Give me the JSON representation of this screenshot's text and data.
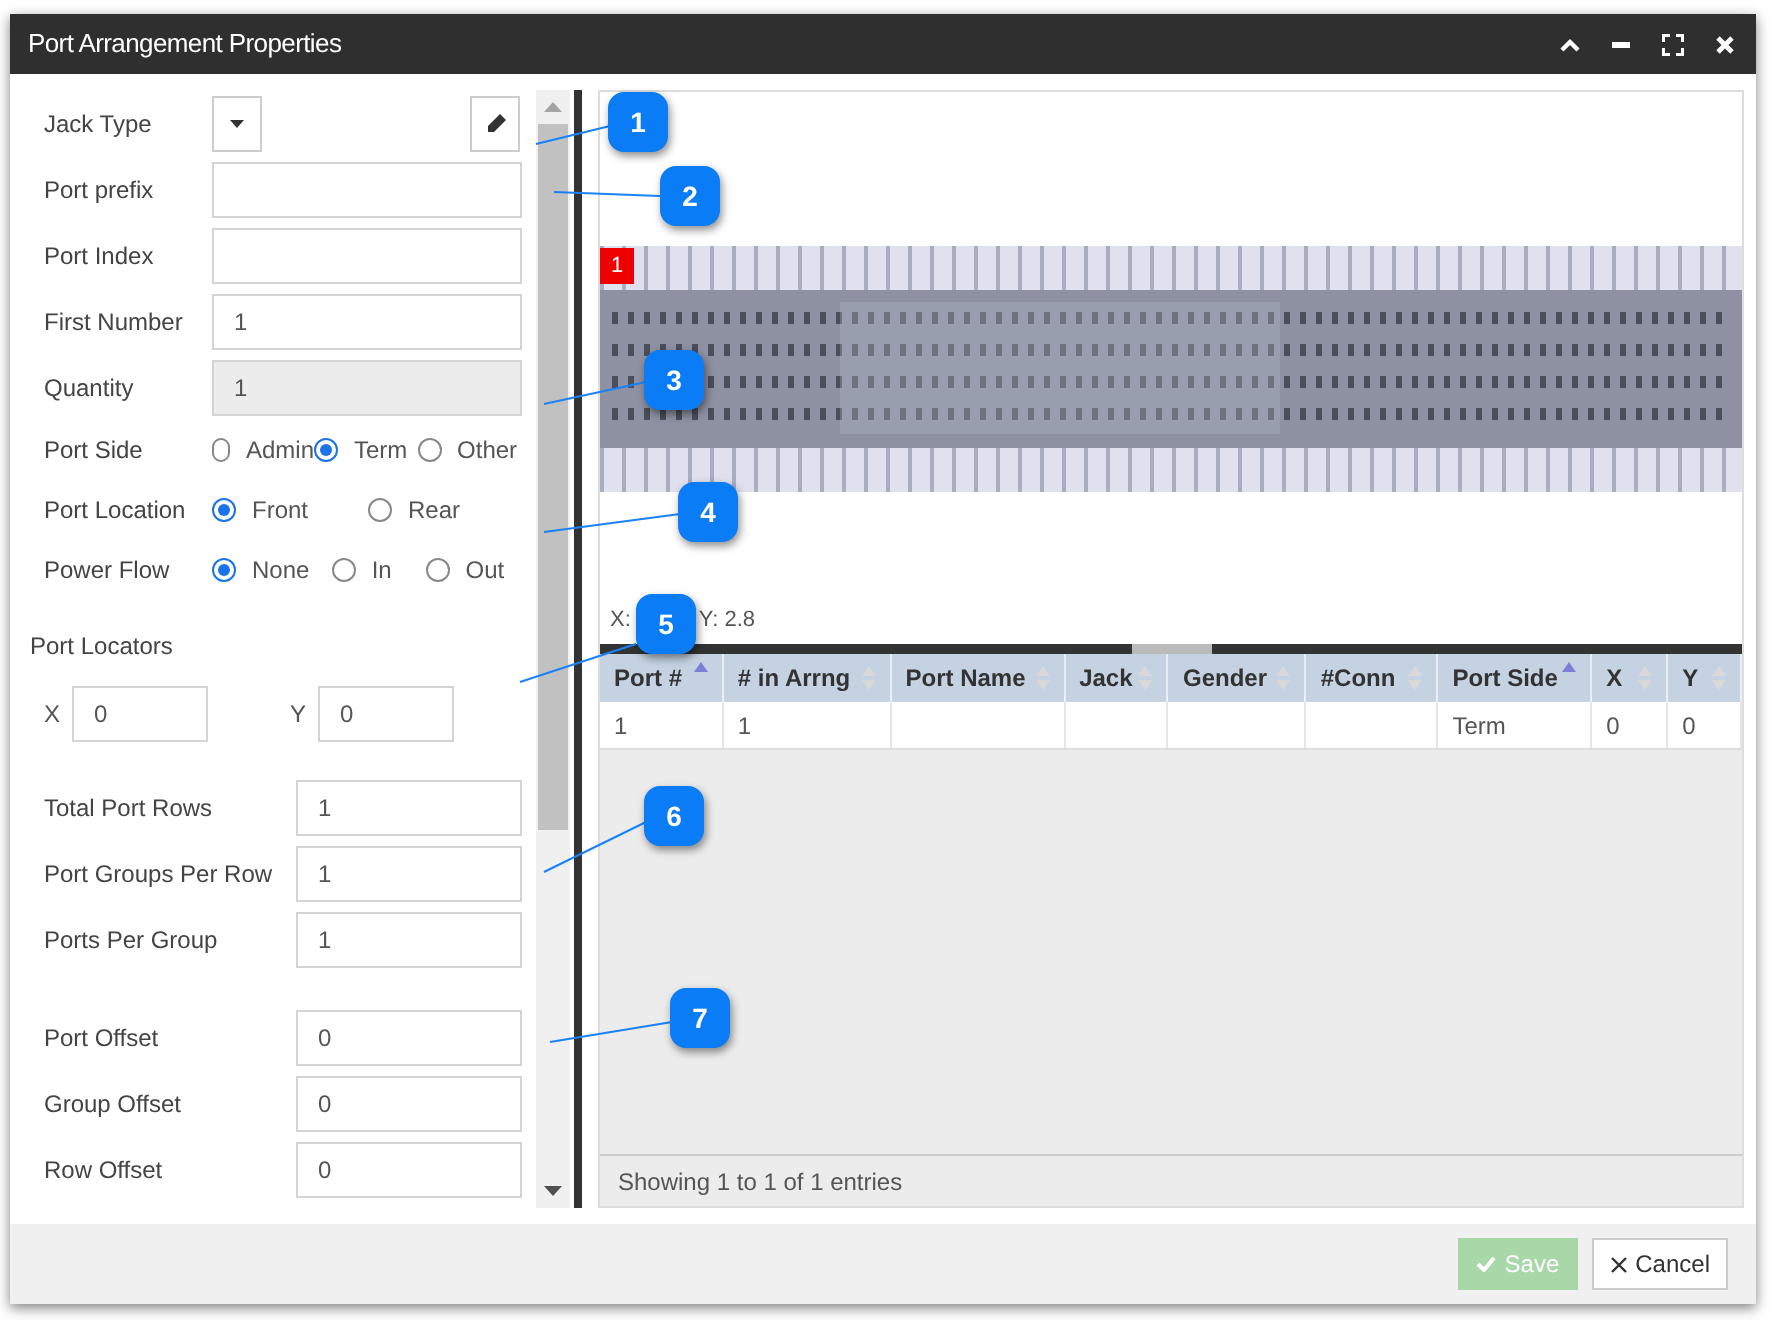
{
  "window": {
    "title": "Port Arrangement Properties"
  },
  "form": {
    "rows": [
      {
        "kind": "dropdown",
        "label": "Jack Type"
      },
      {
        "kind": "text",
        "label": "Port prefix"
      },
      {
        "kind": "text",
        "label": "Port Index"
      },
      {
        "kind": "text",
        "label": "First Number",
        "value": "1"
      },
      {
        "kind": "readonly",
        "label": "Quantity",
        "value": "1"
      },
      {
        "kind": "radio",
        "label": "Port Side",
        "options": [
          {
            "label": "Admin",
            "selected": false
          },
          {
            "label": "Term",
            "selected": true
          },
          {
            "label": "Other",
            "selected": false
          }
        ]
      },
      {
        "kind": "radio",
        "label": "Port Location",
        "options": [
          {
            "label": "Front",
            "selected": true
          },
          {
            "label": "Rear",
            "selected": false
          }
        ]
      },
      {
        "kind": "radio",
        "label": "Power Flow",
        "options": [
          {
            "label": "None",
            "selected": true
          },
          {
            "label": "In",
            "selected": false
          },
          {
            "label": "Out",
            "selected": false
          }
        ]
      }
    ],
    "port_locators": {
      "title": "Port Locators",
      "fields": [
        {
          "label": "X",
          "value": "0"
        },
        {
          "label": "Y",
          "value": "0"
        }
      ]
    },
    "groups": [
      [
        {
          "label": "Total Port Rows",
          "value": "1"
        },
        {
          "label": "Port Groups Per Row",
          "value": "1"
        },
        {
          "label": "Ports Per Group",
          "value": "1"
        }
      ],
      [
        {
          "label": "Port Offset",
          "value": "0"
        },
        {
          "label": "Group Offset",
          "value": "0"
        },
        {
          "label": "Row Offset",
          "value": "0"
        }
      ]
    ]
  },
  "preview": {
    "port_marker": "1",
    "coordinates": [
      "X:",
      "Y: 2.8"
    ]
  },
  "table": {
    "columns": [
      {
        "label": "Port #",
        "sorted": true
      },
      {
        "label": "# in Arrng",
        "sorted": false
      },
      {
        "label": "Port Name",
        "sorted": false
      },
      {
        "label": "Jack",
        "sorted": false
      },
      {
        "label": "Gender",
        "sorted": false
      },
      {
        "label": "#Conn",
        "sorted": false
      },
      {
        "label": "Port Side",
        "sorted": true
      },
      {
        "label": "X",
        "sorted": false
      },
      {
        "label": "Y",
        "sorted": false
      }
    ],
    "rows": [
      [
        "1",
        "1",
        "",
        "",
        "",
        "",
        "Term",
        "0",
        "0"
      ]
    ],
    "info": "Showing 1 to 1 of 1 entries"
  },
  "buttons": [
    {
      "kind": "save",
      "label": "Save",
      "disabled": true
    },
    {
      "kind": "cancel",
      "label": "Cancel",
      "disabled": false
    }
  ],
  "callouts": [
    "1",
    "2",
    "3",
    "4",
    "5",
    "6",
    "7"
  ]
}
